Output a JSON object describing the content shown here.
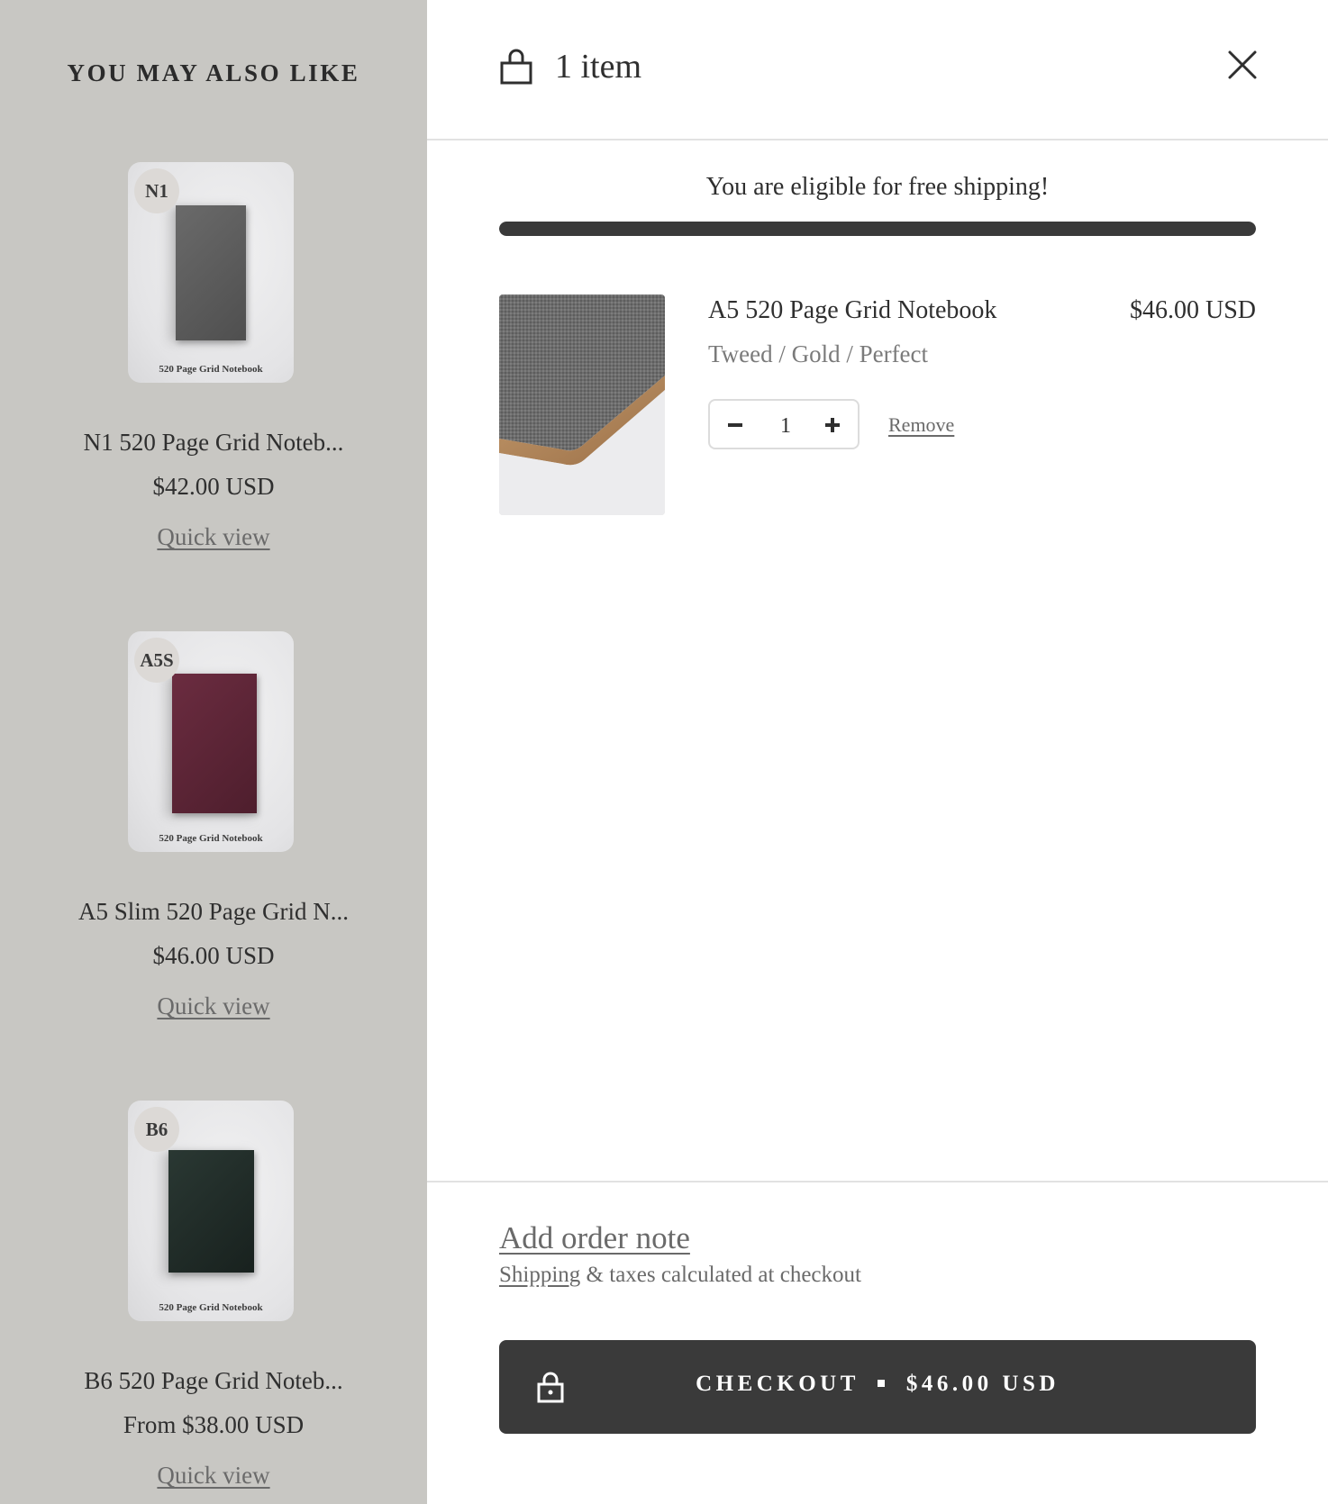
{
  "recommendations": {
    "heading": "YOU MAY ALSO LIKE",
    "items": [
      {
        "badge": "N1",
        "thumb_caption": "520 Page Grid Notebook",
        "title": "N1 520 Page Grid Noteb...",
        "price": "$42.00 USD",
        "quick_view": "Quick view",
        "cover_color": "#5b5b5b"
      },
      {
        "badge": "A5S",
        "thumb_caption": "520 Page Grid Notebook",
        "title": "A5 Slim 520 Page Grid N...",
        "price": "$46.00 USD",
        "quick_view": "Quick view",
        "cover_color": "#5a2434"
      },
      {
        "badge": "B6",
        "thumb_caption": "520 Page Grid Notebook",
        "title": "B6 520 Page Grid Noteb...",
        "price": "From $38.00 USD",
        "quick_view": "Quick view",
        "cover_color": "#1f2b27"
      }
    ]
  },
  "cart": {
    "item_count": "1 item",
    "bag_icon": "shopping-bag-icon",
    "close_icon": "close-icon",
    "shipping_message": "You are eligible for free shipping!",
    "shipping_progress": 1.0,
    "line_items": [
      {
        "name": "A5 520 Page Grid Notebook",
        "price": "$46.00 USD",
        "variant": "Tweed / Gold / Perfect",
        "quantity": "1",
        "remove_label": "Remove",
        "minus_icon": "minus-icon",
        "plus_icon": "plus-icon"
      }
    ],
    "order_note_label": "Add order note",
    "tax_note": {
      "link": "Shipping",
      "rest": " & taxes calculated at checkout"
    },
    "checkout": {
      "label": "CHECKOUT",
      "total": "$46.00 USD",
      "icon": "lock-icon"
    }
  },
  "colors": {
    "panel_bg": "#c8c7c3",
    "button_bg": "#3a3a3a",
    "progress_fill": "#3a3a3a"
  }
}
